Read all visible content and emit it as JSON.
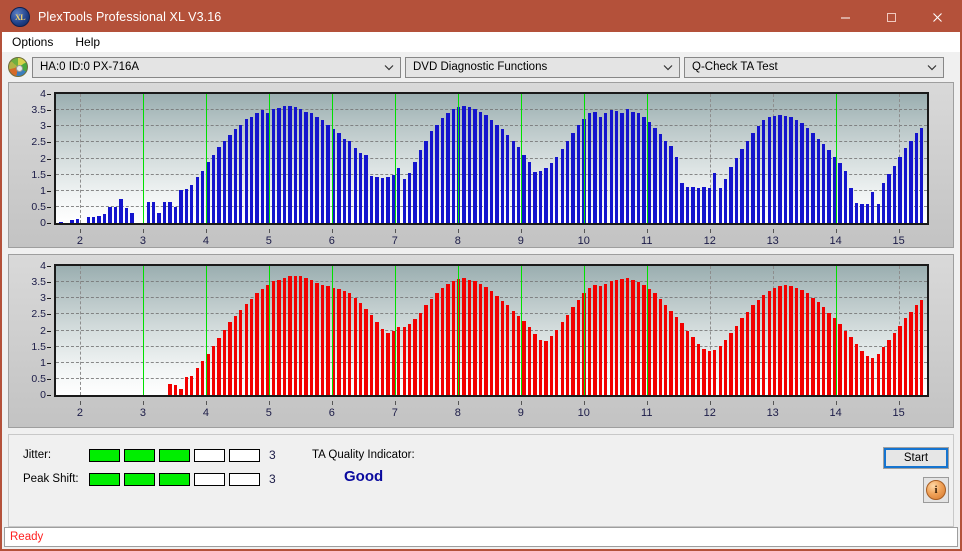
{
  "window": {
    "title": "PlexTools Professional XL V3.16",
    "app_icon": "xl-logo-icon",
    "minimize": "minimize-icon",
    "maximize": "maximize-icon",
    "close": "close-icon",
    "titlebar_color": "#b4513a"
  },
  "menu": {
    "items": [
      "Options",
      "Help"
    ]
  },
  "toolbar": {
    "drive_icon": "disc-icon",
    "drive": "HA:0 ID:0  PX-716A",
    "function": "DVD Diagnostic Functions",
    "test": "Q-Check TA Test",
    "caret": "chevron-down-icon"
  },
  "results": {
    "jitter_label": "Jitter:",
    "jitter_value": "3",
    "jitter_segments": 5,
    "jitter_filled": 3,
    "peak_shift_label": "Peak Shift:",
    "peak_shift_value": "3",
    "peak_shift_segments": 5,
    "peak_shift_filled": 3,
    "segment_on_color": "#00ee00",
    "quality_label": "TA Quality Indicator:",
    "quality_value": "Good",
    "quality_color": "#0a0a9e",
    "start_label": "Start",
    "info_label": "i"
  },
  "statusbar": {
    "text": "Ready",
    "color": "#ff2020"
  },
  "chart_data": [
    {
      "type": "bar",
      "title": "Jitter",
      "series_name": "Jitter",
      "color": "#1414cd",
      "xlabel": "",
      "ylabel": "",
      "xlim": [
        1.62,
        15.45
      ],
      "ylim": [
        0,
        4
      ],
      "yticks": [
        0,
        0.5,
        1,
        1.5,
        2,
        2.5,
        3,
        3.5,
        4
      ],
      "ytick_labels": [
        "0",
        "0.5",
        "1",
        "1.5",
        "2",
        "2.5",
        "3",
        "3.5",
        "4"
      ],
      "xticks": [
        2,
        3,
        4,
        5,
        6,
        7,
        8,
        9,
        10,
        11,
        12,
        13,
        14,
        15
      ],
      "xtick_labels": [
        "2",
        "3",
        "4",
        "5",
        "6",
        "7",
        "8",
        "9",
        "10",
        "11",
        "12",
        "13",
        "14",
        "15"
      ],
      "grid": true,
      "grid_v_at": [
        2,
        12,
        13,
        15
      ],
      "markers_at": [
        3,
        4,
        5,
        6,
        7,
        8,
        9,
        10,
        11,
        14
      ],
      "marker_color": "#00e000",
      "bar_step": 0.0865,
      "x_start": 1.7,
      "values": [
        0.04,
        0.0,
        0.1,
        0.12,
        0.0,
        0.18,
        0.2,
        0.22,
        0.28,
        0.5,
        0.5,
        0.75,
        0.48,
        0.32,
        0.0,
        0.0,
        0.64,
        0.64,
        0.3,
        0.64,
        0.64,
        0.5,
        1.02,
        1.05,
        1.18,
        1.42,
        1.62,
        1.88,
        2.1,
        2.35,
        2.55,
        2.72,
        2.9,
        3.05,
        3.22,
        3.3,
        3.42,
        3.5,
        3.4,
        3.52,
        3.58,
        3.62,
        3.63,
        3.6,
        3.55,
        3.45,
        3.4,
        3.28,
        3.2,
        3.05,
        2.92,
        2.78,
        2.62,
        2.55,
        2.32,
        2.18,
        2.1,
        1.45,
        1.42,
        1.4,
        1.42,
        1.48,
        1.72,
        1.38,
        1.55,
        1.9,
        2.25,
        2.55,
        2.85,
        3.05,
        3.25,
        3.42,
        3.52,
        3.6,
        3.62,
        3.6,
        3.55,
        3.45,
        3.35,
        3.2,
        3.05,
        2.9,
        2.72,
        2.55,
        2.35,
        2.1,
        1.9,
        1.58,
        1.62,
        1.72,
        1.85,
        2.05,
        2.28,
        2.55,
        2.8,
        3.05,
        3.22,
        3.42,
        3.45,
        3.3,
        3.4,
        3.5,
        3.48,
        3.42,
        3.55,
        3.45,
        3.4,
        3.28,
        3.12,
        2.95,
        2.75,
        2.55,
        2.38,
        2.05,
        1.25,
        1.12,
        1.12,
        1.1,
        1.12,
        1.1,
        1.55,
        1.1,
        1.35,
        1.75,
        2.02,
        2.28,
        2.55,
        2.78,
        3.0,
        3.18,
        3.28,
        3.32,
        3.35,
        3.32,
        3.28,
        3.2,
        3.1,
        2.95,
        2.8,
        2.62,
        2.45,
        2.25,
        2.05,
        1.85,
        1.62,
        1.1,
        0.62,
        0.58,
        0.6,
        0.95,
        0.58,
        1.25,
        1.52,
        1.78,
        2.05,
        2.32,
        2.55,
        2.78,
        2.95,
        3.08,
        3.12,
        3.1,
        3.05,
        3.12,
        3.05,
        2.95,
        2.82,
        2.68,
        2.52,
        2.35,
        2.15,
        1.95,
        1.75,
        1.58,
        0.9,
        0.18,
        0.85,
        0.88,
        1.05,
        1.28,
        1.52,
        1.78,
        2.02,
        2.25,
        2.48,
        2.68,
        2.82,
        2.92,
        2.98,
        2.95,
        2.9,
        2.82,
        2.72,
        2.58,
        2.42,
        2.25,
        2.05,
        1.82,
        1.6,
        1.25,
        0.85,
        0.82,
        0.85,
        0.8,
        0.82,
        1.1,
        1.32,
        1.55,
        1.78,
        1.98,
        2.18,
        2.35,
        2.48,
        2.55,
        2.58,
        2.55,
        2.5,
        2.42,
        2.32,
        2.18,
        2.02,
        1.85,
        1.65,
        1.42,
        1.18,
        0.92,
        0.65,
        0.42,
        0.3,
        0.22,
        0.42,
        0.82,
        1.05,
        1.28,
        1.48,
        1.68,
        1.85,
        2.0,
        2.12,
        2.22,
        2.25,
        2.28,
        2.25,
        2.2,
        2.12,
        2.0,
        1.85,
        1.68,
        1.48,
        1.25,
        1.02,
        0.78,
        0.55,
        0.35,
        0.22,
        0.18,
        0.12,
        0.08,
        0.05,
        0.08,
        0.18,
        0.38,
        0.62,
        0.9,
        1.18,
        1.45,
        1.7,
        1.88,
        2.02,
        2.12,
        2.2,
        2.25,
        2.22,
        2.18,
        2.18,
        2.2,
        2.15,
        2.05,
        1.95,
        1.8,
        1.62,
        1.45,
        1.28,
        1.1,
        0.92,
        0.6,
        0.2,
        0.05,
        0.05,
        0.05,
        0.05,
        0.05,
        0.05,
        0.05,
        0.05,
        0.05,
        0.05,
        0.05,
        0.05,
        0.05,
        0.05,
        0.05,
        0.05,
        0.05,
        0.05,
        0.05,
        0.05,
        0.05,
        0.05,
        0.05,
        0.05,
        0.05,
        0.05,
        0.05,
        0.05,
        0.05,
        0.05,
        0.05,
        0.05,
        0.05,
        0.05,
        0.05,
        0.05,
        0.05,
        0.05,
        0.05,
        0.05,
        0.05,
        0.05,
        0.05,
        0.05,
        0.05,
        0.05,
        0.05,
        0.05,
        0.05,
        0.05,
        0.05,
        0.05,
        0.05,
        0.05,
        0.05,
        0.05,
        0.1,
        0.18,
        1.22,
        1.38,
        1.22,
        1.32,
        1.45,
        1.4,
        1.35,
        1.35,
        1.35,
        1.32,
        1.12,
        1.12,
        1.08,
        1.38,
        1.12,
        1.35,
        1.42,
        1.58,
        1.72,
        1.8,
        1.88,
        1.88,
        1.78,
        1.72,
        1.6,
        1.42,
        1.22,
        0.95,
        0.05,
        0.05,
        0.05,
        0.05,
        0.05,
        0.05,
        0.05,
        0.05,
        0.05,
        0.05,
        0.05,
        0.05,
        0.05,
        0.05,
        0.05,
        0.05,
        0.05,
        0.05,
        0.05,
        0.05,
        0.05,
        0.05,
        0.05,
        0.05,
        0.05,
        0.05,
        0.05,
        0.05,
        0.05,
        0.05,
        0.05
      ]
    },
    {
      "type": "bar",
      "title": "Peak Shift",
      "series_name": "Peak Shift",
      "color": "#f20000",
      "xlabel": "",
      "ylabel": "",
      "xlim": [
        1.62,
        15.45
      ],
      "ylim": [
        0,
        4
      ],
      "yticks": [
        0,
        0.5,
        1,
        1.5,
        2,
        2.5,
        3,
        3.5,
        4
      ],
      "ytick_labels": [
        "0",
        "0.5",
        "1",
        "1.5",
        "2",
        "2.5",
        "3",
        "3.5",
        "4"
      ],
      "xticks": [
        2,
        3,
        4,
        5,
        6,
        7,
        8,
        9,
        10,
        11,
        12,
        13,
        14,
        15
      ],
      "xtick_labels": [
        "2",
        "3",
        "4",
        "5",
        "6",
        "7",
        "8",
        "9",
        "10",
        "11",
        "12",
        "13",
        "14",
        "15"
      ],
      "grid": true,
      "grid_v_at": [
        2,
        12,
        13,
        15
      ],
      "markers_at": [
        3,
        4,
        5,
        6,
        7,
        8,
        9,
        10,
        11,
        14
      ],
      "marker_color": "#00e000",
      "bar_step": 0.0865,
      "x_start": 1.7,
      "values": [
        0.0,
        0.0,
        0.0,
        0.0,
        0.0,
        0.0,
        0.0,
        0.0,
        0.0,
        0.0,
        0.0,
        0.0,
        0.0,
        0.0,
        0.0,
        0.0,
        0.0,
        0.0,
        0.0,
        0.0,
        0.35,
        0.32,
        0.2,
        0.55,
        0.58,
        0.85,
        1.05,
        1.28,
        1.52,
        1.78,
        2.02,
        2.25,
        2.45,
        2.65,
        2.82,
        2.98,
        3.15,
        3.3,
        3.42,
        3.52,
        3.58,
        3.62,
        3.68,
        3.7,
        3.68,
        3.62,
        3.58,
        3.48,
        3.42,
        3.38,
        3.32,
        3.28,
        3.22,
        3.15,
        3.0,
        2.85,
        2.68,
        2.48,
        2.25,
        2.05,
        1.92,
        2.0,
        2.1,
        2.12,
        2.2,
        2.35,
        2.55,
        2.78,
        2.98,
        3.15,
        3.32,
        3.45,
        3.55,
        3.6,
        3.62,
        3.58,
        3.52,
        3.45,
        3.35,
        3.22,
        3.08,
        2.92,
        2.78,
        2.62,
        2.45,
        2.28,
        2.1,
        1.88,
        1.72,
        1.68,
        1.82,
        2.02,
        2.25,
        2.48,
        2.72,
        2.95,
        3.15,
        3.32,
        3.42,
        3.38,
        3.45,
        3.55,
        3.58,
        3.6,
        3.62,
        3.58,
        3.5,
        3.42,
        3.3,
        3.15,
        2.98,
        2.8,
        2.62,
        2.42,
        2.22,
        2.0,
        1.8,
        1.58,
        1.42,
        1.38,
        1.4,
        1.52,
        1.7,
        1.92,
        2.15,
        2.38,
        2.58,
        2.78,
        2.95,
        3.1,
        3.22,
        3.32,
        3.38,
        3.4,
        3.38,
        3.32,
        3.25,
        3.15,
        3.02,
        2.88,
        2.72,
        2.55,
        2.38,
        2.2,
        2.0,
        1.8,
        1.58,
        1.38,
        1.22,
        1.15,
        1.28,
        1.48,
        1.7,
        1.92,
        2.15,
        2.38,
        2.58,
        2.78,
        2.95,
        3.08,
        3.18,
        3.25,
        3.28,
        3.3,
        3.25,
        3.18,
        3.08,
        2.95,
        2.82,
        2.68,
        2.52,
        2.35,
        2.18,
        2.0,
        1.8,
        1.58,
        1.35,
        1.15,
        1.02,
        1.08,
        1.22,
        1.42,
        1.62,
        1.82,
        2.02,
        2.22,
        2.42,
        2.6,
        2.75,
        2.88,
        2.98,
        3.05,
        3.08,
        3.05,
        3.0,
        2.92,
        2.82,
        2.7,
        2.55,
        2.38,
        2.2,
        2.02,
        1.82,
        1.62,
        1.42,
        1.22,
        1.05,
        0.95,
        1.05,
        1.22,
        1.42,
        1.62,
        1.82,
        2.0,
        2.18,
        2.35,
        2.5,
        2.62,
        2.72,
        2.78,
        2.8,
        2.78,
        2.72,
        2.62,
        2.52,
        2.38,
        2.22,
        2.05,
        1.88,
        1.68,
        1.48,
        1.28,
        1.08,
        0.92,
        0.8,
        0.88,
        1.02,
        1.22,
        1.42,
        1.62,
        1.82,
        2.0,
        2.15,
        2.28,
        2.38,
        2.45,
        2.45,
        2.42,
        2.38,
        2.3,
        2.2,
        2.08,
        1.95,
        1.8,
        1.62,
        1.45,
        1.25,
        1.05,
        0.88,
        0.7,
        0.55,
        0.45,
        0.4,
        0.62,
        0.82,
        1.02,
        1.25,
        1.48,
        1.7,
        1.9,
        2.05,
        2.18,
        2.25,
        2.3,
        2.28,
        2.22,
        2.15,
        2.05,
        1.92,
        1.78,
        1.62,
        1.45,
        1.28,
        1.1,
        0.92,
        0.75,
        0.58,
        0.08,
        0.08,
        0.08,
        0.06,
        0.06,
        0.06,
        0.06,
        0.06,
        0.06,
        0.06,
        0.06,
        0.06,
        0.06,
        0.06,
        0.12,
        0.06,
        0.06,
        0.06,
        0.06,
        0.06,
        0.06,
        0.1,
        0.06,
        0.06,
        0.06,
        0.06,
        0.06,
        0.06,
        0.06,
        0.06,
        0.06,
        0.06,
        0.06,
        0.06,
        0.06,
        0.12,
        0.06,
        0.06,
        0.06,
        0.1,
        0.06,
        0.06,
        0.06,
        0.06,
        0.06,
        0.06,
        0.06,
        0.06,
        0.06,
        0.06,
        0.06,
        0.06,
        0.06,
        0.06,
        0.06,
        0.1,
        0.06,
        0.06,
        0.62,
        0.88,
        0.58,
        0.06,
        0.95,
        1.12,
        0.95,
        0.82,
        0.72,
        0.85,
        0.6,
        0.55,
        0.45,
        0.58,
        0.3,
        0.06,
        0.06,
        0.12,
        0.06,
        0.06,
        0.12,
        0.06,
        0.06,
        0.06,
        0.12,
        0.06,
        0.06,
        0.06,
        0.06,
        0.06,
        0.06,
        0.06,
        0.06,
        0.06,
        0.06,
        0.12,
        0.12,
        0.06,
        0.06,
        0.06,
        0.06,
        0.06,
        0.06,
        0.06,
        0.06,
        0.06,
        0.06,
        0.06,
        0.06,
        0.06,
        0.06,
        0.06,
        0.06,
        0.06,
        0.06,
        0.06,
        0.06,
        0.06,
        0.12
      ]
    }
  ]
}
